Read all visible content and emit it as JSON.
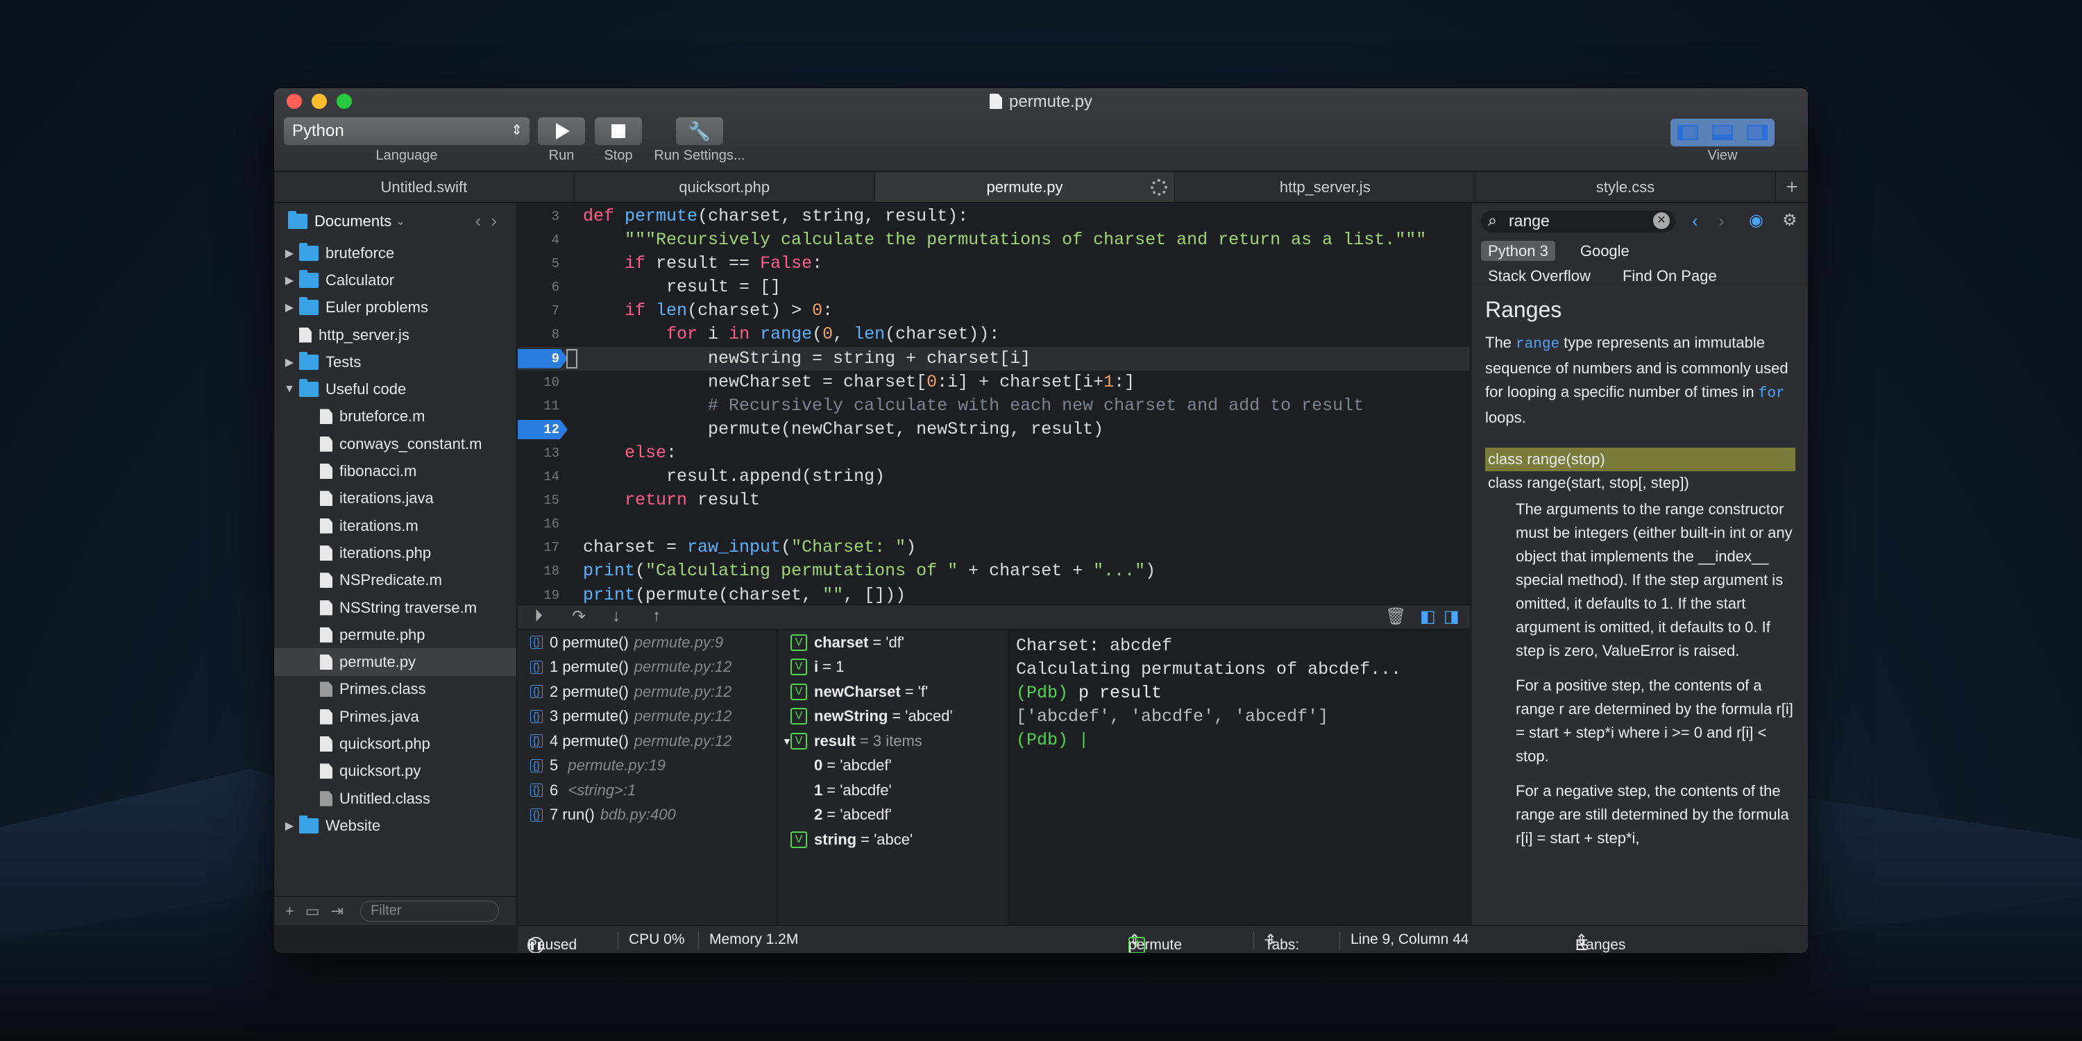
{
  "window": {
    "title": "permute.py"
  },
  "toolbar": {
    "language": "Python",
    "language_label": "Language",
    "run_label": "Run",
    "stop_label": "Stop",
    "settings_label": "Run Settings...",
    "view_label": "View"
  },
  "tabs": [
    "Untitled.swift",
    "quicksort.php",
    "permute.py",
    "http_server.js",
    "style.css"
  ],
  "sidebar": {
    "root": "Documents",
    "filter_placeholder": "Filter",
    "items": [
      {
        "label": "bruteforce",
        "kind": "folder",
        "depth": 0,
        "expanded": false
      },
      {
        "label": "Calculator",
        "kind": "folder",
        "depth": 0,
        "expanded": false
      },
      {
        "label": "Euler problems",
        "kind": "folder",
        "depth": 0,
        "expanded": false
      },
      {
        "label": "http_server.js",
        "kind": "file",
        "depth": 0
      },
      {
        "label": "Tests",
        "kind": "folder",
        "depth": 0,
        "expanded": false
      },
      {
        "label": "Useful code",
        "kind": "folder",
        "depth": 0,
        "expanded": true
      },
      {
        "label": "bruteforce.m",
        "kind": "file",
        "depth": 1
      },
      {
        "label": "conways_constant.m",
        "kind": "file",
        "depth": 1
      },
      {
        "label": "fibonacci.m",
        "kind": "file",
        "depth": 1
      },
      {
        "label": "iterations.java",
        "kind": "file",
        "depth": 1
      },
      {
        "label": "iterations.m",
        "kind": "file",
        "depth": 1
      },
      {
        "label": "iterations.php",
        "kind": "file",
        "depth": 1
      },
      {
        "label": "NSPredicate.m",
        "kind": "file",
        "depth": 1
      },
      {
        "label": "NSString traverse.m",
        "kind": "file",
        "depth": 1
      },
      {
        "label": "permute.php",
        "kind": "file",
        "depth": 1
      },
      {
        "label": "permute.py",
        "kind": "file",
        "depth": 1,
        "selected": true
      },
      {
        "label": "Primes.class",
        "kind": "class",
        "depth": 1
      },
      {
        "label": "Primes.java",
        "kind": "file",
        "depth": 1
      },
      {
        "label": "quicksort.php",
        "kind": "file",
        "depth": 1
      },
      {
        "label": "quicksort.py",
        "kind": "file",
        "depth": 1
      },
      {
        "label": "Untitled.class",
        "kind": "class",
        "depth": 1
      },
      {
        "label": "Website",
        "kind": "folder",
        "depth": 0,
        "expanded": false
      }
    ]
  },
  "editor": {
    "lines": [
      {
        "n": "3",
        "html": "<span class='kw'>def</span> <span class='fn'>permute</span>(charset, string, result):"
      },
      {
        "n": "4",
        "html": "    <span class='st'>\"\"\"Recursively calculate the permutations of charset and return as a list.\"\"\"</span>"
      },
      {
        "n": "5",
        "html": "    <span class='kw'>if</span> result == <span class='kw'>False</span>:"
      },
      {
        "n": "6",
        "html": "        result = []"
      },
      {
        "n": "7",
        "html": "    <span class='kw'>if</span> <span class='fn'>len</span>(charset) &gt; <span class='nm'>0</span>:"
      },
      {
        "n": "8",
        "html": "        <span class='kw'>for</span> i <span class='kw'>in</span> <span class='fn'>range</span>(<span class='nm'>0</span>, <span class='fn'>len</span>(charset)):"
      },
      {
        "n": "9",
        "html": "            newString = string + charset[i]",
        "bp": true,
        "current": true
      },
      {
        "n": "10",
        "html": "            newCharset = charset[<span class='nm'>0</span>:i] + charset[i+<span class='nm'>1</span>:]"
      },
      {
        "n": "11",
        "html": "            <span class='cm'># Recursively calculate with each new charset and add to result</span>"
      },
      {
        "n": "12",
        "html": "            permute(newCharset, newString, result)",
        "bp": true
      },
      {
        "n": "13",
        "html": "    <span class='kw'>else</span>:"
      },
      {
        "n": "14",
        "html": "        result.append(string)"
      },
      {
        "n": "15",
        "html": "    <span class='kw'>return</span> result"
      },
      {
        "n": "16",
        "html": ""
      },
      {
        "n": "17",
        "html": "charset = <span class='fn'>raw_input</span>(<span class='st'>\"Charset: \"</span>)"
      },
      {
        "n": "18",
        "html": "<span class='fn'>print</span>(<span class='st'>\"Calculating permutations of \"</span> + charset + <span class='st'>\"...\"</span>)"
      },
      {
        "n": "19",
        "html": "<span class='fn'>print</span>(permute(charset, <span class='st'>\"\"</span>, []))"
      }
    ]
  },
  "stack": [
    {
      "idx": "0",
      "fn": "permute()",
      "loc": "permute.py:9"
    },
    {
      "idx": "1",
      "fn": "permute()",
      "loc": "permute.py:12"
    },
    {
      "idx": "2",
      "fn": "permute()",
      "loc": "permute.py:12"
    },
    {
      "idx": "3",
      "fn": "permute()",
      "loc": "permute.py:12"
    },
    {
      "idx": "4",
      "fn": "permute()",
      "loc": "permute.py:12"
    },
    {
      "idx": "5",
      "fn": "",
      "loc": "permute.py:19"
    },
    {
      "idx": "6",
      "fn": "",
      "loc": "<string>:1"
    },
    {
      "idx": "7",
      "fn": "run()",
      "loc": "bdb.py:400"
    }
  ],
  "variables": [
    {
      "name": "charset",
      "value": "= 'df'",
      "badge": true
    },
    {
      "name": "i",
      "value": "= 1",
      "badge": true
    },
    {
      "name": "newCharset",
      "value": "= 'f'",
      "badge": true
    },
    {
      "name": "newString",
      "value": "= 'abced'",
      "badge": true
    },
    {
      "name": "result",
      "value": "= 3 items",
      "badge": true,
      "expanded": true
    },
    {
      "name": "0",
      "value": "= 'abcdef'",
      "child": true
    },
    {
      "name": "1",
      "value": "= 'abcdfe'",
      "child": true
    },
    {
      "name": "2",
      "value": "= 'abcedf'",
      "child": true
    },
    {
      "name": "string",
      "value": "= 'abce'",
      "badge": true
    }
  ],
  "console": {
    "lines": [
      "Charset: abcdef",
      "Calculating permutations of abcdef...",
      "(Pdb) p result",
      "['abcdef', 'abcdfe', 'abcedf']",
      "(Pdb) |"
    ]
  },
  "docs": {
    "search": "range",
    "sources": [
      "Python 3",
      "Google",
      "Stack Overflow",
      "Find On Page"
    ],
    "heading": "Ranges",
    "intro_a": "The ",
    "intro_code": "range",
    "intro_b": " type represents an immutable sequence of numbers and is commonly used for looping a specific number of times in ",
    "intro_code2": "for",
    "intro_c": " loops.",
    "sig1": "class range(stop)",
    "sig2": "class range(start, stop[, step])",
    "p1": "The arguments to the range constructor must be integers (either built-in int or any object that implements the __index__ special method). If the step argument is omitted, it defaults to 1. If the start argument is omitted, it defaults to 0. If step is zero, ValueError is raised.",
    "p2": "For a positive step, the contents of a range r are determined by the formula r[i] = start + step*i where i >= 0 and r[i] < stop.",
    "p3": "For a negative step, the contents of the range are still determined by the formula r[i] = start + step*i,"
  },
  "status": {
    "state": "Paused",
    "cpu": "CPU 0%",
    "memory": "Memory 1.2M",
    "function": "permute",
    "tabs": "Tabs: 4",
    "position": "Line 9, Column 44",
    "docs_section": "Ranges"
  }
}
